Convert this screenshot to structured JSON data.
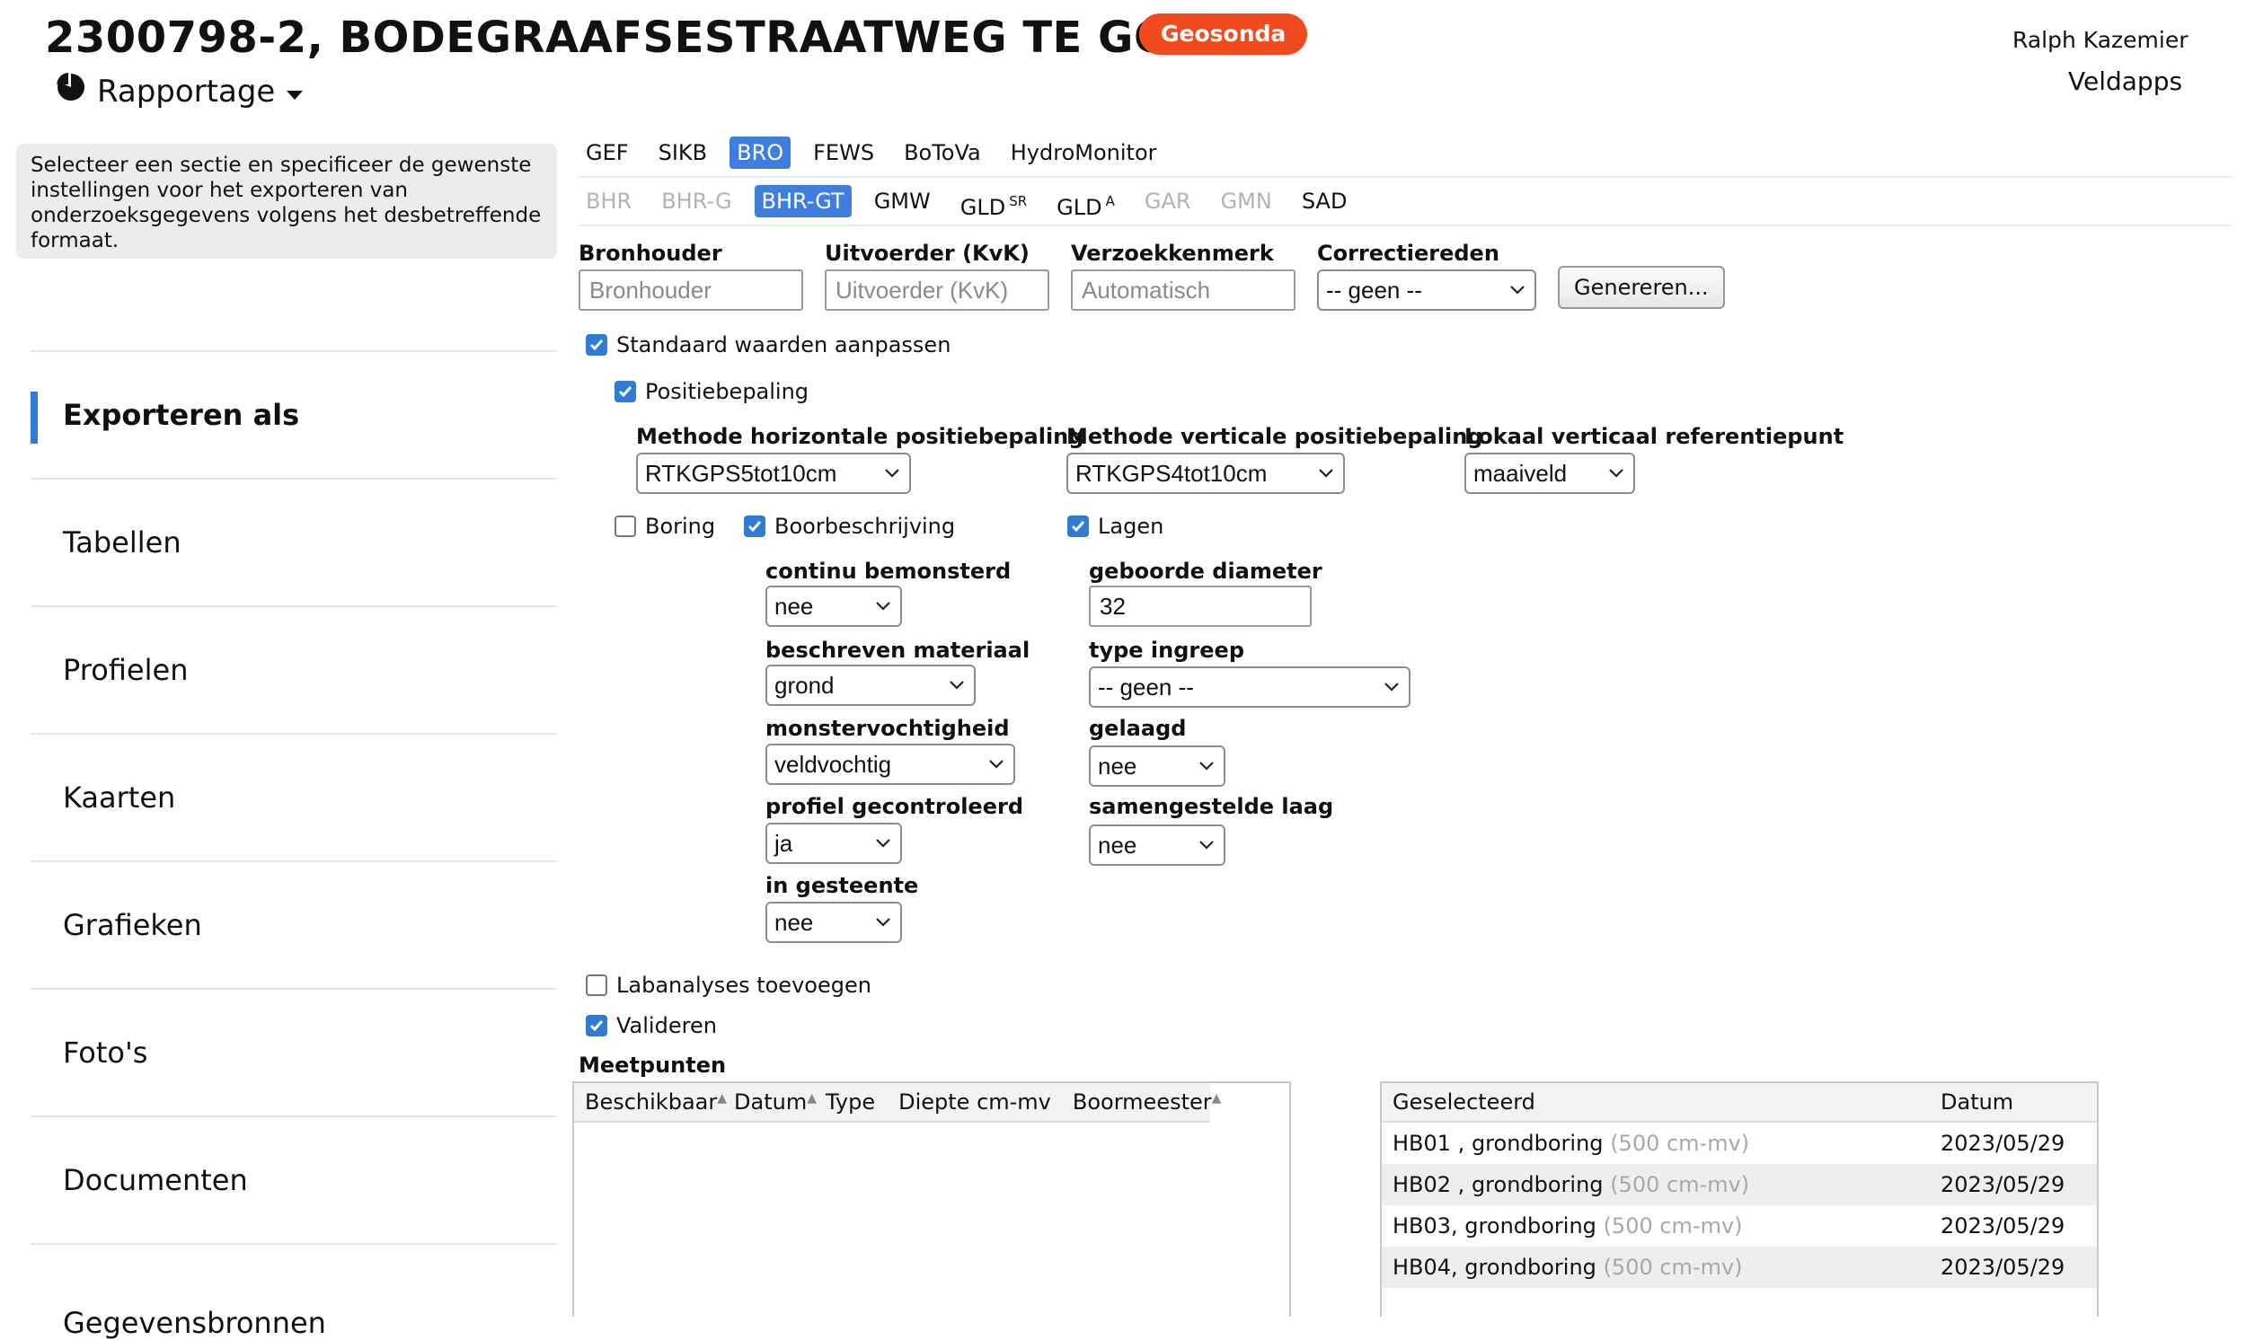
{
  "header": {
    "project_title": "2300798-2, BODEGRAAFSESTRAATWEG TE GOUDA",
    "brand": "Geosonda",
    "menu_label": "Rapportage",
    "user_name": "Ralph Kazemier",
    "app_name": "Veldapps"
  },
  "sidebar": {
    "info": "Selecteer een sectie en specificeer de gewenste instellingen voor het exporteren van onderzoeksgegevens volgens het desbetreffende formaat.",
    "items": [
      {
        "label": "Exporteren als"
      },
      {
        "label": "Tabellen"
      },
      {
        "label": "Profielen"
      },
      {
        "label": "Kaarten"
      },
      {
        "label": "Grafieken"
      },
      {
        "label": "Foto's"
      },
      {
        "label": "Documenten"
      },
      {
        "label": "Gegevensbronnen"
      }
    ]
  },
  "tabs_primary": [
    {
      "label": "GEF"
    },
    {
      "label": "SIKB"
    },
    {
      "label": "BRO",
      "active": true
    },
    {
      "label": "FEWS"
    },
    {
      "label": "BoToVa"
    },
    {
      "label": "HydroMonitor"
    }
  ],
  "tabs_secondary": [
    {
      "label": "BHR",
      "sup": ""
    },
    {
      "label": "BHR-G",
      "sup": ""
    },
    {
      "label": "BHR-GT",
      "sup": ""
    },
    {
      "label": "GMW",
      "sup": ""
    },
    {
      "label": "GLD",
      "sup": "SR"
    },
    {
      "label": "GLD",
      "sup": "A"
    },
    {
      "label": "GAR",
      "sup": ""
    },
    {
      "label": "GMN",
      "sup": ""
    },
    {
      "label": "SAD",
      "sup": ""
    }
  ],
  "form": {
    "bronhouder": {
      "label": "Bronhouder",
      "placeholder": "Bronhouder"
    },
    "uitvoerder": {
      "label": "Uitvoerder (KvK)",
      "placeholder": "Uitvoerder (KvK)"
    },
    "verzoekkenmerk": {
      "label": "Verzoekkenmerk",
      "placeholder": "Automatisch"
    },
    "correctiereden": {
      "label": "Correctiereden",
      "value": "-- geen --"
    },
    "generate_button": "Genereren...",
    "standaard": {
      "label": "Standaard waarden aanpassen",
      "checked": true
    },
    "positiebepaling": {
      "label": "Positiebepaling",
      "checked": true
    },
    "methode_horizontaal": {
      "label": "Methode horizontale positiebepaling",
      "value": "RTKGPS5tot10cm"
    },
    "methode_verticaal": {
      "label": "Methode verticale positiebepaling",
      "value": "RTKGPS4tot10cm"
    },
    "lokaal_referentiepunt": {
      "label": "Lokaal verticaal referentiepunt",
      "value": "maaiveld"
    },
    "boring": {
      "label": "Boring",
      "checked": false
    },
    "boorbeschrijving": {
      "label": "Boorbeschrijving",
      "checked": true
    },
    "lagen": {
      "label": "Lagen",
      "checked": true
    },
    "continu_bemonsterd": {
      "label": "continu bemonsterd",
      "value": "nee"
    },
    "beschreven_materiaal": {
      "label": "beschreven materiaal",
      "value": "grond"
    },
    "monstervochtigheid": {
      "label": "monstervochtigheid",
      "value": "veldvochtig"
    },
    "profiel_gecontroleerd": {
      "label": "profiel gecontroleerd",
      "value": "ja"
    },
    "in_gesteente": {
      "label": "in gesteente",
      "value": "nee"
    },
    "geboorde_diameter": {
      "label": "geboorde diameter",
      "value": "32"
    },
    "type_ingreep": {
      "label": "type ingreep",
      "value": "-- geen --"
    },
    "gelaagd": {
      "label": "gelaagd",
      "value": "nee"
    },
    "samengestelde_laag": {
      "label": "samengestelde laag",
      "value": "nee"
    },
    "labanalyses": {
      "label": "Labanalyses toevoegen",
      "checked": false
    },
    "valideren": {
      "label": "Valideren",
      "checked": true
    }
  },
  "meetpunten": {
    "title": "Meetpunten",
    "columns": [
      "Beschikbaar",
      "Datum",
      "Type",
      "Diepte cm-mv",
      "Boormeester"
    ]
  },
  "selected": {
    "columns": [
      "Geselecteerd",
      "Datum"
    ],
    "rows": [
      {
        "name": "HB01 , grondboring",
        "depth": "(500 cm-mv)",
        "date": "2023/05/29"
      },
      {
        "name": "HB02 , grondboring",
        "depth": "(500 cm-mv)",
        "date": "2023/05/29"
      },
      {
        "name": "HB03, grondboring",
        "depth": "(500 cm-mv)",
        "date": "2023/05/29"
      },
      {
        "name": "HB04, grondboring",
        "depth": "(500 cm-mv)",
        "date": "2023/05/29"
      }
    ]
  },
  "colors": {
    "accent": "#2f7bd6",
    "brand": "#f14a1e",
    "tab_active": "#3d7ee0"
  }
}
